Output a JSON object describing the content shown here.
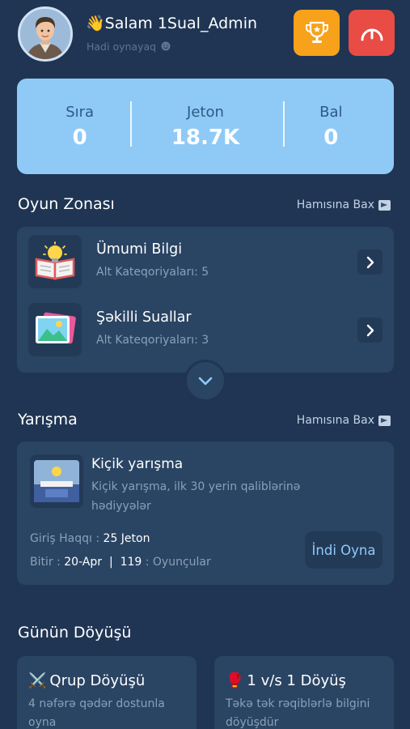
{
  "header": {
    "greeting_emoji": "👋",
    "greeting": "Salam 1Sual_Admin",
    "subtitle": "Hadi oynayaq"
  },
  "stats": [
    {
      "label": "Sıra",
      "value": "0"
    },
    {
      "label": "Jeton",
      "value": "18.7K"
    },
    {
      "label": "Bal",
      "value": "0"
    }
  ],
  "zone": {
    "title": "Oyun Zonası",
    "see_all": "Hamısına Bax",
    "items": [
      {
        "title": "Ümumi Bilgi",
        "subtitle": "Alt Kateqoriyaları: 5"
      },
      {
        "title": "Şəkilli Suallar",
        "subtitle": "Alt Kateqoriyaları: 3"
      }
    ]
  },
  "competition": {
    "title": "Yarışma",
    "see_all": "Hamısına Bax",
    "card": {
      "title": "Kiçik yarışma",
      "description": "Kiçik yarışma, ilk 30 yerin qaliblərinə hədiyyələr",
      "entry_label": "Giriş Haqqı :",
      "entry_value": "25 Jeton",
      "end_label": "Bitir :",
      "end_value": "20-Apr",
      "separator": "|",
      "players_count": "119",
      "players_label": ": Oyunçular",
      "play_button": "İndi Oyna"
    }
  },
  "battle": {
    "title": "Günün Döyüşü",
    "items": [
      {
        "icon": "⚔️",
        "title": "Qrup Döyüşü",
        "description": "4 nəfərə qədər dostunla oyna"
      },
      {
        "icon": "🥊",
        "title": "1 v/s 1 Döyüş",
        "description": "Təkə tək rəqiblərlə bilgini döyüşdür"
      }
    ]
  },
  "colors": {
    "background": "#1f3553",
    "card": "#2a4463",
    "stats_panel": "#8fcaf7",
    "trophy_button": "#f7a21a",
    "exit_button": "#e84c44"
  }
}
